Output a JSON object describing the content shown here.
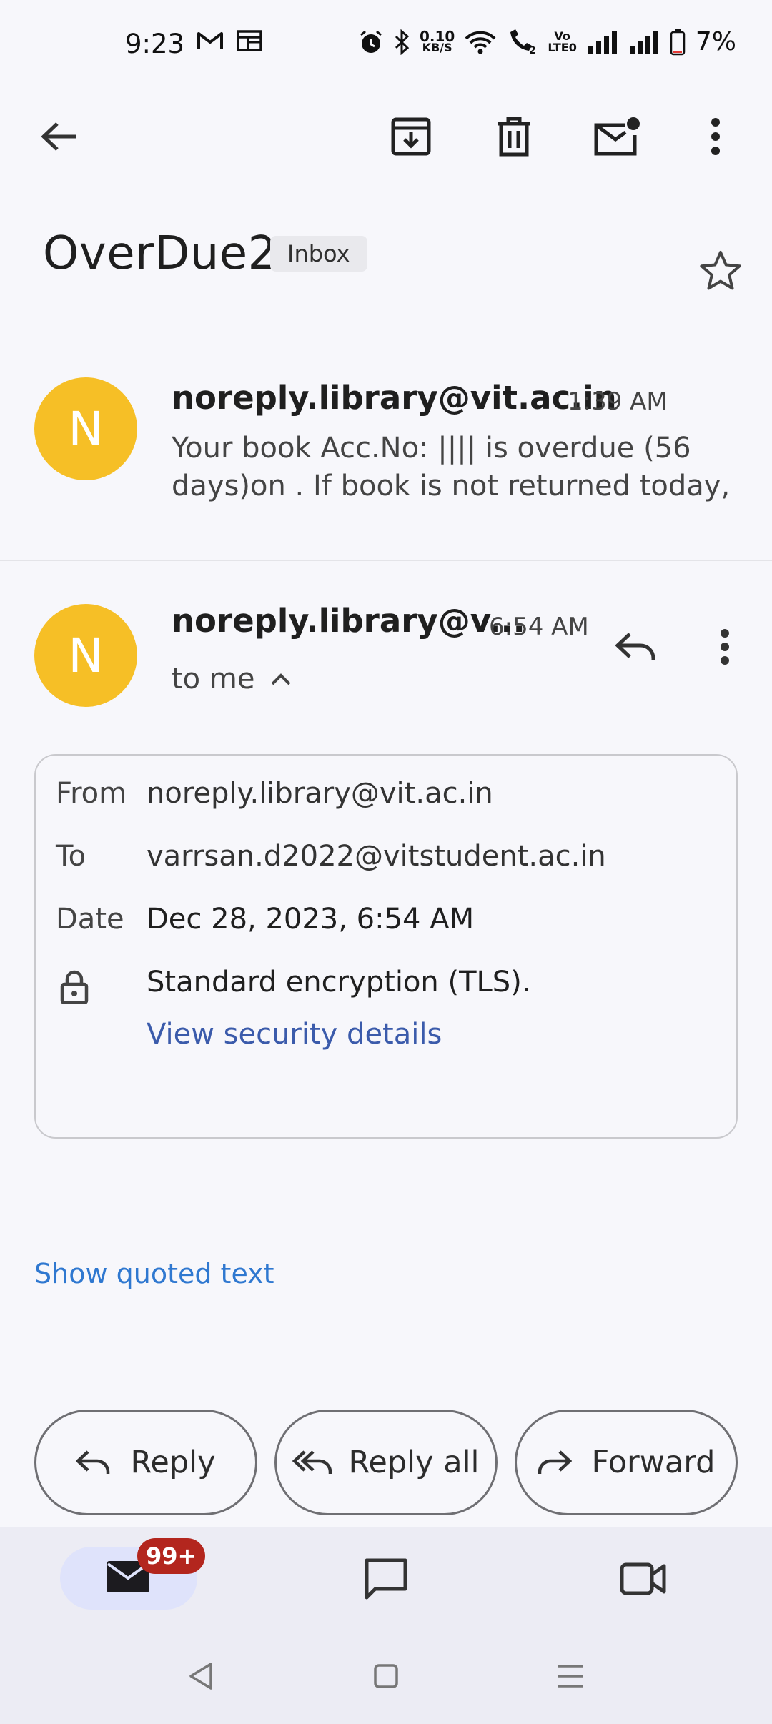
{
  "status_bar": {
    "time": "9:23",
    "net_speed_top": "0.10",
    "net_speed_bottom": "KB/S",
    "volte_top": "Vo",
    "volte_bottom": "LTE0",
    "battery": "7%"
  },
  "toolbar": {
    "back_icon": "arrow-left-icon",
    "archive_icon": "archive-icon",
    "delete_icon": "trash-icon",
    "unread_icon": "mark-unread-icon",
    "more_icon": "more-vert-icon"
  },
  "subject": {
    "title": "OverDue2",
    "label": "Inbox"
  },
  "messages": [
    {
      "avatar_letter": "N",
      "sender": "noreply.library@vit.ac.in",
      "time": "1:39 AM",
      "snippet_line1": "Your book Acc.No: |||| is overdue (56",
      "snippet_line2": "days)on . If book is not returned today,"
    },
    {
      "avatar_letter": "N",
      "sender": "noreply.library@v...",
      "time": "6:54 AM",
      "recipient_summary": "to me"
    }
  ],
  "details": {
    "from_label": "From",
    "from_value": "noreply.library@vit.ac.in",
    "to_label": "To",
    "to_value": "varrsan.d2022@vitstudent.ac.in",
    "date_label": "Date",
    "date_value": "Dec 28, 2023, 6:54 AM",
    "security_text": "Standard encryption (TLS).",
    "security_link": "View security details"
  },
  "show_quoted": "Show quoted text",
  "actions": {
    "reply": "Reply",
    "reply_all": "Reply all",
    "forward": "Forward"
  },
  "bottom_nav": {
    "mail_badge": "99+"
  },
  "colors": {
    "avatar": "#f6bf26",
    "link": "#3b5bab",
    "quoted": "#2f78d0",
    "badge": "#b3261e",
    "nav_bg": "#ececf4",
    "nav_selected": "#dfe3fb"
  }
}
